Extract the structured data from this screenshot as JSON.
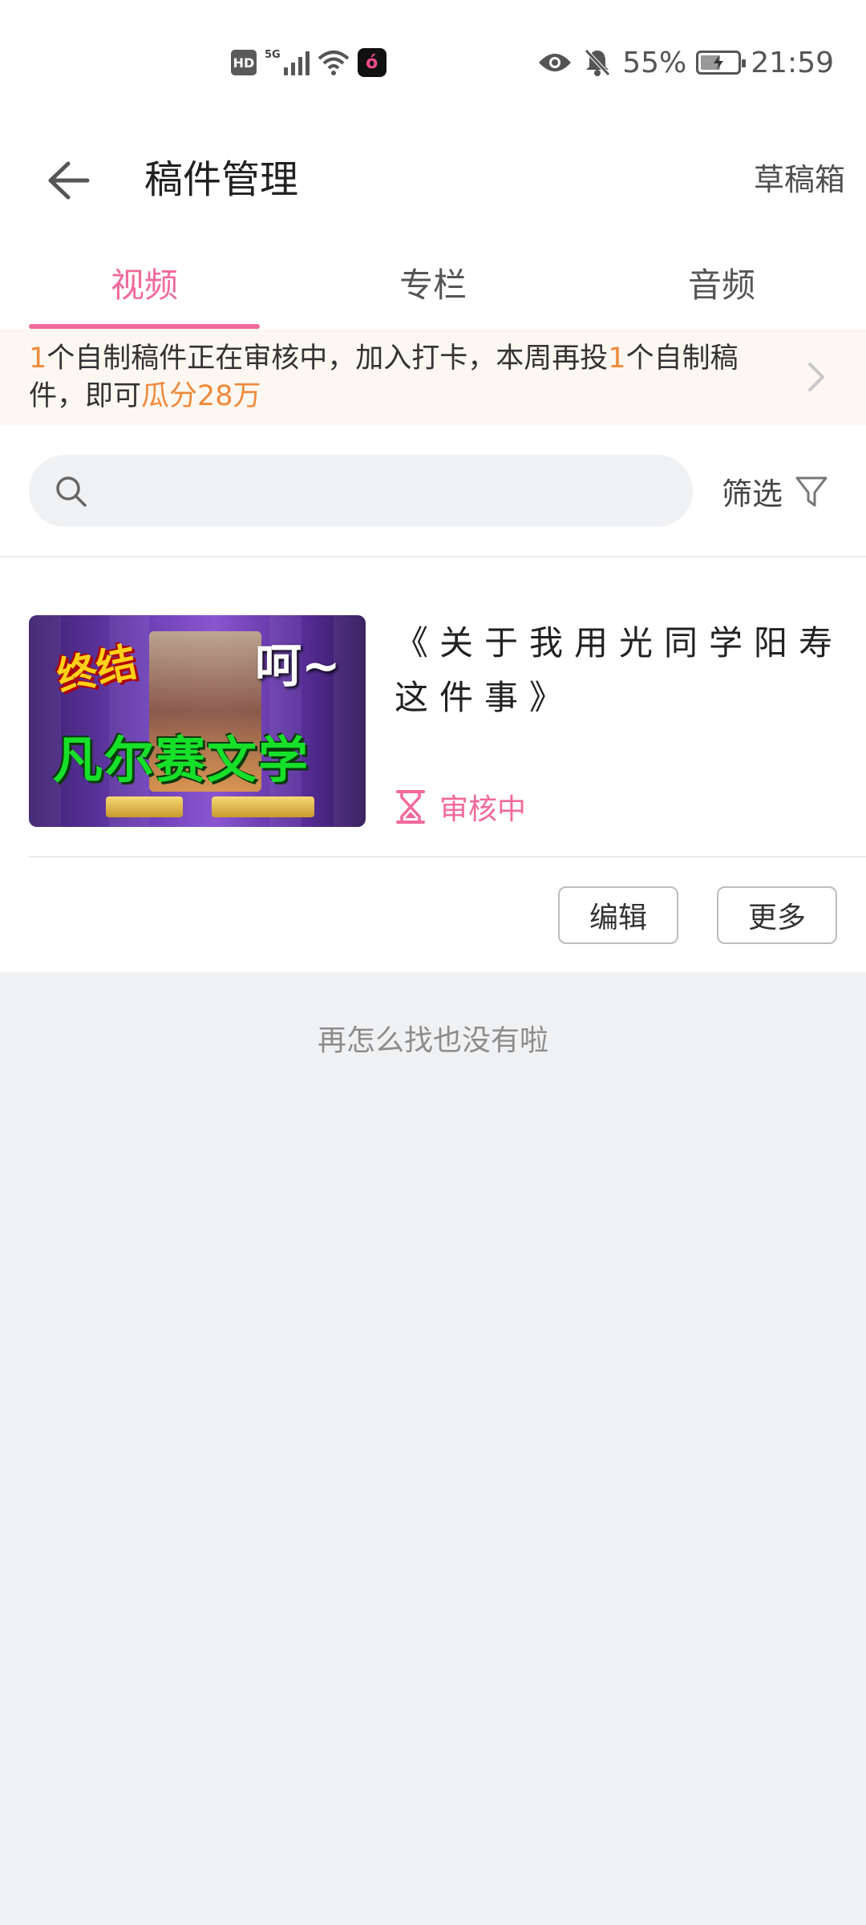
{
  "status_bar": {
    "hd": "HD",
    "network": "5G",
    "app_glyph": "ó",
    "battery_percent": "55%",
    "battery_level": 0.55,
    "time": "21:59",
    "icons": [
      "hd-icon",
      "signal-icon",
      "wifi-icon",
      "app-icon",
      "eye-icon",
      "bell-off-icon",
      "battery-icon"
    ]
  },
  "header": {
    "title": "稿件管理",
    "drafts_label": "草稿箱"
  },
  "tabs": [
    {
      "label": "视频",
      "active": true
    },
    {
      "label": "专栏",
      "active": false
    },
    {
      "label": "音频",
      "active": false
    }
  ],
  "notice": {
    "count1": "1",
    "text1": "个自制稿件正在审核中，加入打卡，本周再投",
    "count2": "1",
    "text2": "个自制稿件，即可",
    "reward": "瓜分28万"
  },
  "search": {
    "value": "",
    "placeholder": ""
  },
  "filter_label": "筛选",
  "video": {
    "thumbnail_text_1": "终结",
    "thumbnail_text_2": "呵~",
    "thumbnail_text_3": "凡尔赛文学",
    "title": "《关于我用光同学阳寿这件事》",
    "status": "审核中",
    "edit_label": "编辑",
    "more_label": "更多"
  },
  "colors": {
    "accent": "#f06a9b",
    "highlight": "#f08a3b"
  },
  "end_text": "再怎么找也没有啦"
}
